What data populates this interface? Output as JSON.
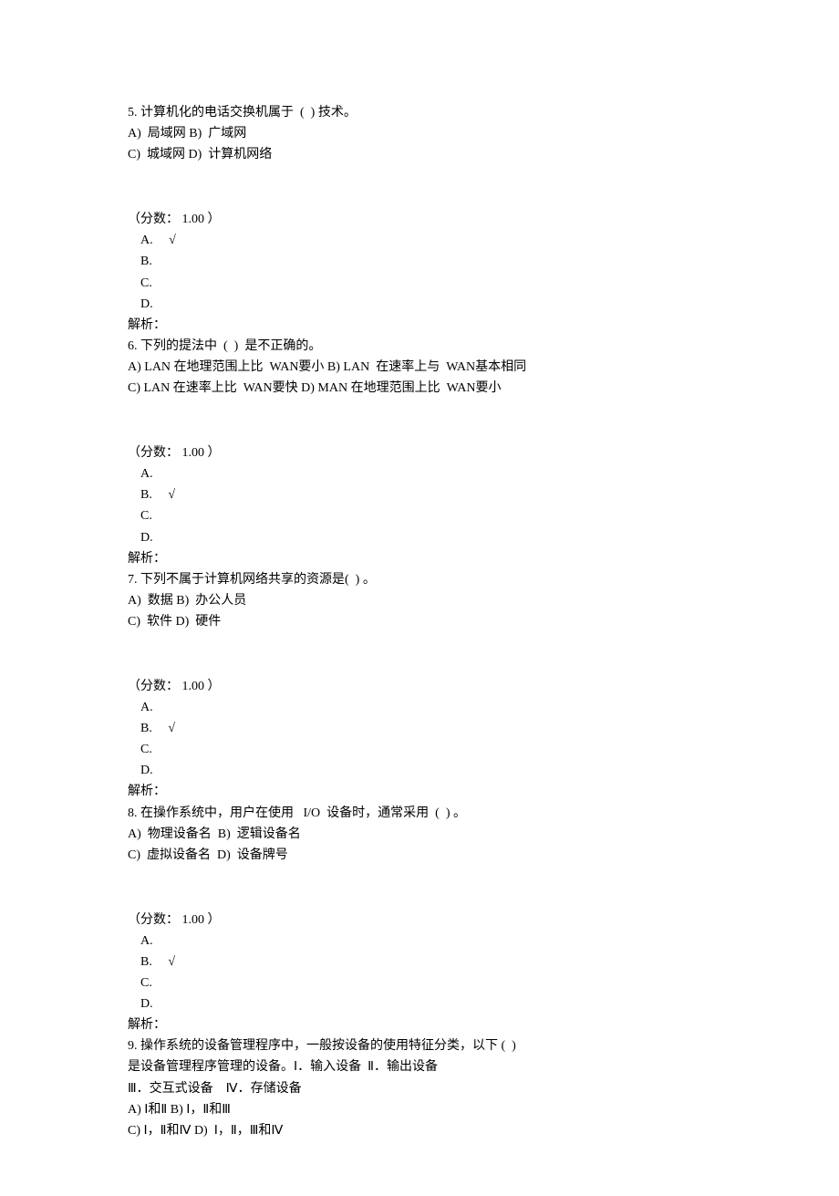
{
  "questions": [
    {
      "num": "5.",
      "stem": "计算机化的电话交换机属于  (  ) 技术。",
      "opts_line1": "A)  局域网 B)  广域网",
      "opts_line2": "C)  城域网 D)  计算机网络",
      "score_label": "（分数： 1.00 ）",
      "choices": [
        {
          "label": "A.",
          "mark": "√"
        },
        {
          "label": "B.",
          "mark": ""
        },
        {
          "label": "C.",
          "mark": ""
        },
        {
          "label": "D.",
          "mark": ""
        }
      ],
      "explain": "解析："
    },
    {
      "num": "6.",
      "stem": "下列的提法中  (  )  是不正确的。",
      "opts_line1": "A) LAN 在地理范围上比  WAN要小 B) LAN  在速率上与  WAN基本相同",
      "opts_line2": "C) LAN 在速率上比  WAN要快 D) MAN 在地理范围上比  WAN要小",
      "score_label": "（分数： 1.00 ）",
      "choices": [
        {
          "label": "A.",
          "mark": ""
        },
        {
          "label": "B.",
          "mark": "√"
        },
        {
          "label": "C.",
          "mark": ""
        },
        {
          "label": "D.",
          "mark": ""
        }
      ],
      "explain": "解析："
    },
    {
      "num": "7.",
      "stem": "下列不属于计算机网络共享的资源是(  ) 。",
      "opts_line1": "A)  数据 B)  办公人员",
      "opts_line2": "C)  软件 D)  硬件",
      "score_label": "（分数： 1.00 ）",
      "choices": [
        {
          "label": "A.",
          "mark": ""
        },
        {
          "label": "B.",
          "mark": "√"
        },
        {
          "label": "C.",
          "mark": ""
        },
        {
          "label": "D.",
          "mark": ""
        }
      ],
      "explain": "解析："
    },
    {
      "num": "8.",
      "stem": "在操作系统中，用户在使用   I/O  设备时，通常采用  (  ) 。",
      "opts_line1": "A)  物理设备名  B)  逻辑设备名",
      "opts_line2": "C)  虚拟设备名  D)  设备牌号",
      "score_label": "（分数： 1.00 ）",
      "choices": [
        {
          "label": "A.",
          "mark": ""
        },
        {
          "label": "B.",
          "mark": "√"
        },
        {
          "label": "C.",
          "mark": ""
        },
        {
          "label": "D.",
          "mark": ""
        }
      ],
      "explain": "解析："
    },
    {
      "num": "9.",
      "stem": "操作系统的设备管理程序中，一般按设备的使用特征分类，以下 (  )",
      "stem2": "是设备管理程序管理的设备。Ⅰ．输入设备  Ⅱ．输出设备",
      "stem3": "Ⅲ．交互式设备    Ⅳ．存储设备",
      "opts_line1": "A) Ⅰ和Ⅱ B) Ⅰ，Ⅱ和Ⅲ",
      "opts_line2": "C) Ⅰ，Ⅱ和Ⅳ D)  Ⅰ，Ⅱ，Ⅲ和Ⅳ"
    }
  ]
}
